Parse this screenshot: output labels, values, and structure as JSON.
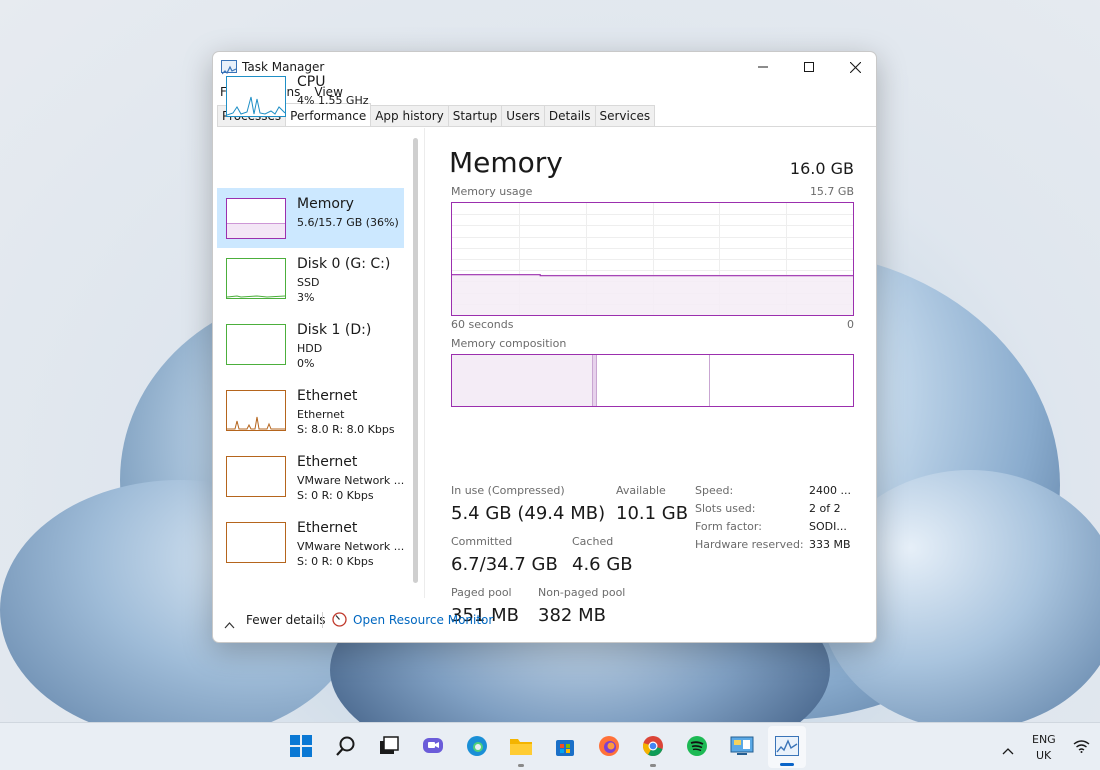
{
  "window": {
    "title": "Task Manager",
    "controls": {
      "minimize": "—",
      "maximize": "☐",
      "close": "✕"
    }
  },
  "menu": [
    "File",
    "Options",
    "View"
  ],
  "tabs": [
    {
      "label": "Processes",
      "active": false
    },
    {
      "label": "Performance",
      "active": true
    },
    {
      "label": "App history",
      "active": false
    },
    {
      "label": "Startup",
      "active": false
    },
    {
      "label": "Users",
      "active": false
    },
    {
      "label": "Details",
      "active": false
    },
    {
      "label": "Services",
      "active": false
    }
  ],
  "sidebar": {
    "items": [
      {
        "name": "CPU",
        "line1": "4%  1.55 GHz",
        "line2": "",
        "line3": "",
        "color": "#1f8fc6"
      },
      {
        "name": "Memory",
        "line1": "5.6/15.7 GB (36%)",
        "line2": "",
        "line3": "",
        "color": "#9b2fae"
      },
      {
        "name": "Disk 0 (G: C:)",
        "line1": "SSD",
        "line2": "3%",
        "line3": "",
        "color": "#4caf3c"
      },
      {
        "name": "Disk 1 (D:)",
        "line1": "HDD",
        "line2": "0%",
        "line3": "",
        "color": "#4caf3c"
      },
      {
        "name": "Ethernet",
        "line1": "Ethernet",
        "line2": "S: 8.0  R: 8.0 Kbps",
        "line3": "",
        "color": "#b5651d"
      },
      {
        "name": "Ethernet",
        "line1": "VMware Network ...",
        "line2": "S: 0  R: 0 Kbps",
        "line3": "",
        "color": "#b5651d"
      },
      {
        "name": "Ethernet",
        "line1": "VMware Network ...",
        "line2": "S: 0  R: 0 Kbps",
        "line3": "",
        "color": "#b5651d"
      }
    ]
  },
  "main": {
    "title": "Memory",
    "total": "16.0 GB",
    "usage_label": "Memory usage",
    "usage_max": "15.7 GB",
    "axis_left": "60 seconds",
    "axis_right": "0",
    "composition_label": "Memory composition",
    "usage_fraction": 0.36,
    "stats": {
      "in_use_label": "In use (Compressed)",
      "in_use_value": "5.4 GB (49.4 MB)",
      "available_label": "Available",
      "available_value": "10.1 GB",
      "committed_label": "Committed",
      "committed_value": "6.7/34.7 GB",
      "cached_label": "Cached",
      "cached_value": "4.6 GB",
      "paged_label": "Paged pool",
      "paged_value": "351 MB",
      "nonpaged_label": "Non-paged pool",
      "nonpaged_value": "382 MB"
    },
    "specs": [
      {
        "label": "Speed:",
        "value": "2400 ..."
      },
      {
        "label": "Slots used:",
        "value": "2 of 2"
      },
      {
        "label": "Form factor:",
        "value": "SODI..."
      },
      {
        "label": "Hardware reserved:",
        "value": "333 MB"
      }
    ]
  },
  "footer": {
    "fewer_details": "Fewer details",
    "open_resource_monitor": "Open Resource Monitor"
  },
  "taskbar": {
    "tray_lang_1": "ENG",
    "tray_lang_2": "UK"
  },
  "colors": {
    "memory_accent": "#9b2fae",
    "selected_bg": "#cce8ff",
    "link": "#0067c0"
  }
}
